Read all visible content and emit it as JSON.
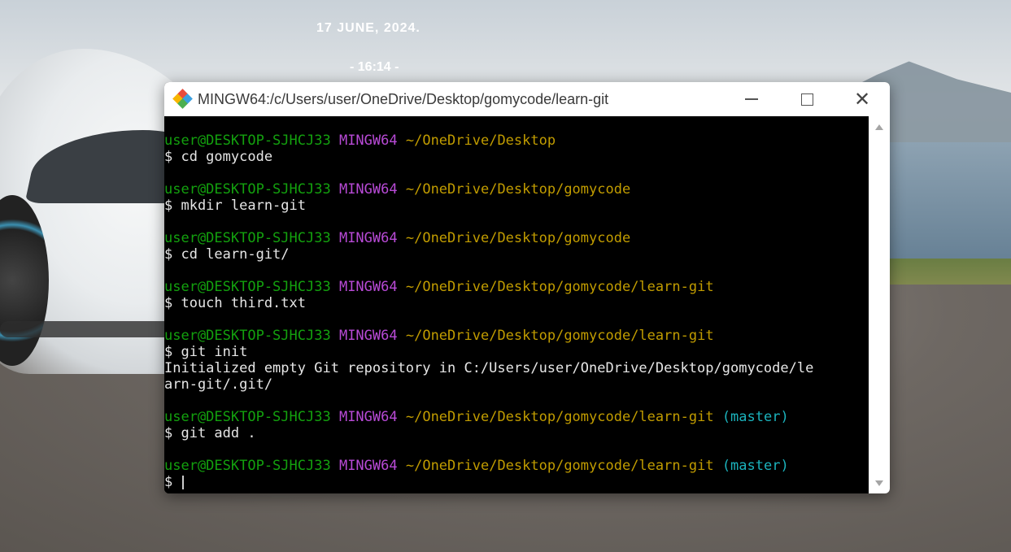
{
  "desktop": {
    "date": "17 JUNE, 2024.",
    "time": "- 16:14 -"
  },
  "window": {
    "title": "MINGW64:/c/Users/user/OneDrive/Desktop/gomycode/learn-git",
    "controls": {
      "minimize": "—",
      "maximize": "☐",
      "close": "✕"
    }
  },
  "terminal": {
    "blocks": [
      {
        "user": "user@DESKTOP-SJHCJ33",
        "shell": "MINGW64",
        "path": "~/OneDrive/Desktop",
        "branch": "",
        "command": "$ cd gomycode",
        "output": []
      },
      {
        "user": "user@DESKTOP-SJHCJ33",
        "shell": "MINGW64",
        "path": "~/OneDrive/Desktop/gomycode",
        "branch": "",
        "command": "$ mkdir learn-git",
        "output": []
      },
      {
        "user": "user@DESKTOP-SJHCJ33",
        "shell": "MINGW64",
        "path": "~/OneDrive/Desktop/gomycode",
        "branch": "",
        "command": "$ cd learn-git/",
        "output": []
      },
      {
        "user": "user@DESKTOP-SJHCJ33",
        "shell": "MINGW64",
        "path": "~/OneDrive/Desktop/gomycode/learn-git",
        "branch": "",
        "command": "$ touch third.txt",
        "output": []
      },
      {
        "user": "user@DESKTOP-SJHCJ33",
        "shell": "MINGW64",
        "path": "~/OneDrive/Desktop/gomycode/learn-git",
        "branch": "",
        "command": "$ git init",
        "output": [
          "Initialized empty Git repository in C:/Users/user/OneDrive/Desktop/gomycode/le",
          "arn-git/.git/"
        ]
      },
      {
        "user": "user@DESKTOP-SJHCJ33",
        "shell": "MINGW64",
        "path": "~/OneDrive/Desktop/gomycode/learn-git",
        "branch": "(master)",
        "command": "$ git add .",
        "output": []
      },
      {
        "user": "user@DESKTOP-SJHCJ33",
        "shell": "MINGW64",
        "path": "~/OneDrive/Desktop/gomycode/learn-git",
        "branch": "(master)",
        "command": "$ ",
        "output": []
      }
    ]
  },
  "colors": {
    "user": "#13a10e",
    "shell": "#b84ad6",
    "path": "#c19c00",
    "branch": "#1bb3bd",
    "text": "#e6e6e6",
    "terminal_bg": "#000000"
  },
  "icons": {
    "app": "git-diamond-icon",
    "scroll_up": "scroll-up-arrow-icon",
    "scroll_down": "scroll-down-arrow-icon"
  }
}
